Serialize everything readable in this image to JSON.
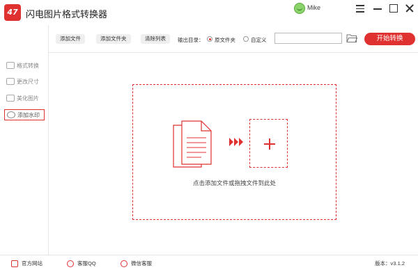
{
  "app": {
    "logo_text": "47",
    "title": "闪电图片格式转换器",
    "user": "Mike",
    "brand_color": "#e03131"
  },
  "window_controls": [
    "menu-icon",
    "minimize-icon",
    "maximize-icon",
    "close-icon"
  ],
  "sidebar": {
    "items": [
      {
        "label": "格式转换",
        "icon": "convert-icon",
        "active": false
      },
      {
        "label": "更改尺寸",
        "icon": "resize-icon",
        "active": false
      },
      {
        "label": "美化图片",
        "icon": "beautify-icon",
        "active": false
      },
      {
        "label": "添加水印",
        "icon": "watermark-icon",
        "active": true
      }
    ]
  },
  "toolbar": {
    "add_file": "添加文件",
    "add_folder": "添加文件夹",
    "clear_list": "清除列表",
    "output_label": "输出目录：",
    "radio_original": "原文件夹",
    "radio_custom": "自定义",
    "selected_output": "原文件夹",
    "path_value": "",
    "start_button": "开始转换"
  },
  "dropzone": {
    "hint": "点击添加文件或拖拽文件到此处"
  },
  "footer": {
    "website": "官方网站",
    "qq": "客服QQ",
    "wechat": "微信客服",
    "version": "版本：v3.1.2"
  }
}
